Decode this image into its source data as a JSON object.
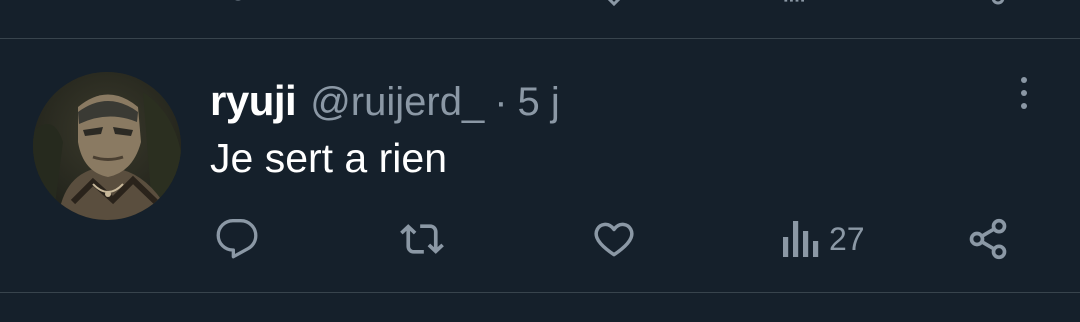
{
  "tweet": {
    "display_name": "ryuji",
    "handle": "@ruijerd_",
    "separator": "·",
    "time": "5 j",
    "text": "Je sert a rien",
    "views_count": "27"
  },
  "icons": {
    "more": "more-vertical-icon",
    "reply": "reply-icon",
    "retweet": "retweet-icon",
    "like": "heart-icon",
    "views": "views-icon",
    "share": "share-icon"
  },
  "colors": {
    "background": "#15202b",
    "text_primary": "#ffffff",
    "text_secondary": "#8b98a5",
    "divider": "#38444d"
  }
}
